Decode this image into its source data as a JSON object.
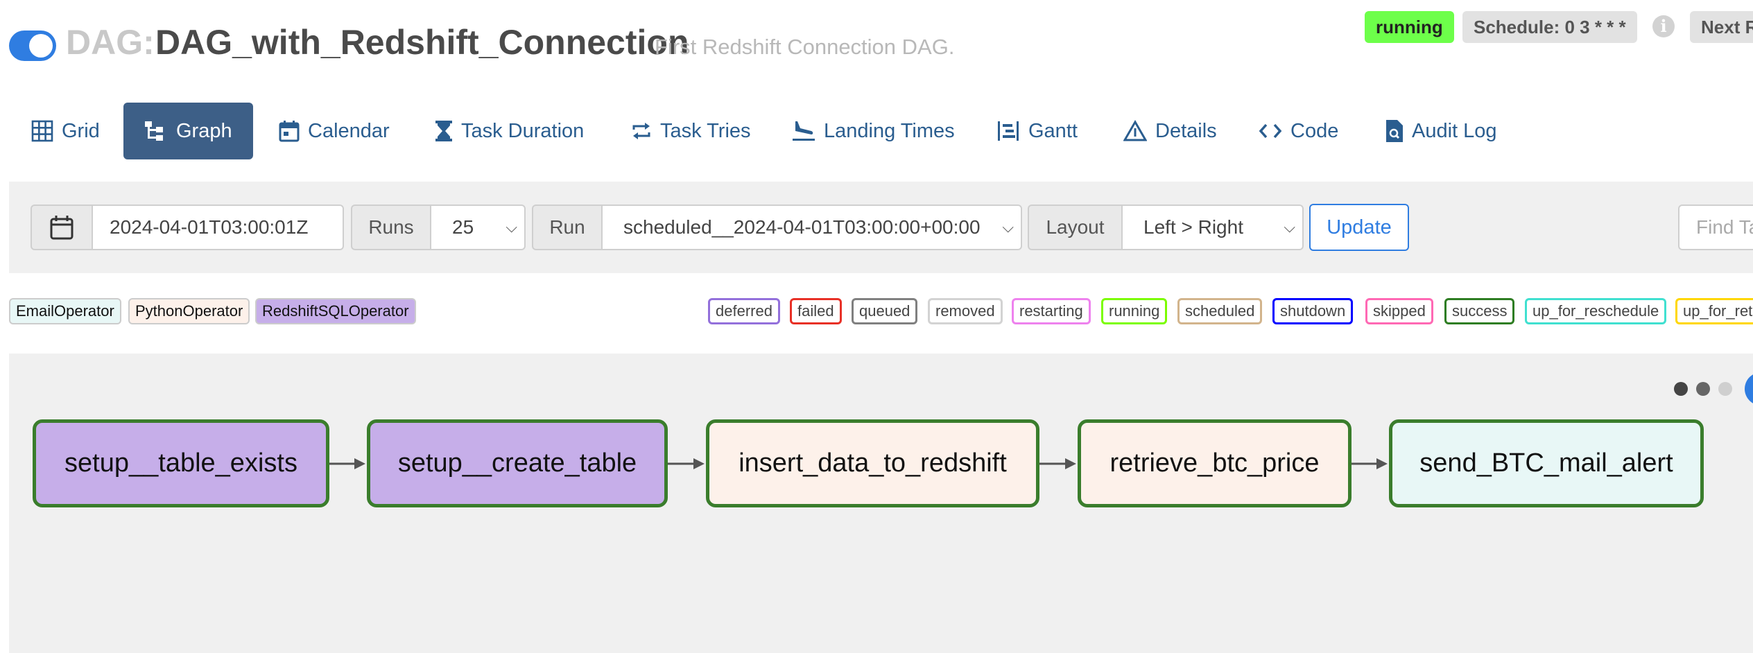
{
  "header": {
    "dag_prefix": "DAG:",
    "dag_name": "DAG_with_Redshift_Connection",
    "description": "First Redshift Connection DAG.",
    "state_badge": "running",
    "schedule_badge": "Schedule: 0 3 * * *",
    "info_icon": "i",
    "next_run_badge": "Next R"
  },
  "tabs": [
    {
      "label": "Grid",
      "icon": "grid-icon",
      "active": false
    },
    {
      "label": "Graph",
      "icon": "graph-icon",
      "active": true
    },
    {
      "label": "Calendar",
      "icon": "calendar-icon",
      "active": false
    },
    {
      "label": "Task Duration",
      "icon": "hourglass-icon",
      "active": false
    },
    {
      "label": "Task Tries",
      "icon": "repeat-icon",
      "active": false
    },
    {
      "label": "Landing Times",
      "icon": "plane-landing-icon",
      "active": false
    },
    {
      "label": "Gantt",
      "icon": "gantt-icon",
      "active": false
    },
    {
      "label": "Details",
      "icon": "warning-triangle-icon",
      "active": false
    },
    {
      "label": "Code",
      "icon": "code-icon",
      "active": false
    },
    {
      "label": "Audit Log",
      "icon": "search-document-icon",
      "active": false
    }
  ],
  "toolbar": {
    "base_date": "2024-04-01T03:00:01Z",
    "runs_label": "Runs",
    "runs_value": "25",
    "run_label": "Run",
    "run_value": "scheduled__2024-04-01T03:00:00+00:00",
    "layout_label": "Layout",
    "layout_value": "Left > Right",
    "update_label": "Update",
    "find_placeholder": "Find Ta"
  },
  "operator_legend": [
    {
      "label": "EmailOperator",
      "color": "#e8f7f6"
    },
    {
      "label": "PythonOperator",
      "color": "#fdf1ea"
    },
    {
      "label": "RedshiftSQLOperator",
      "color": "#c6aee9"
    }
  ],
  "state_legend": [
    {
      "label": "deferred",
      "color": "#9370db"
    },
    {
      "label": "failed",
      "color": "#e83026"
    },
    {
      "label": "queued",
      "color": "#808080"
    },
    {
      "label": "removed",
      "color": "#d3d3d3"
    },
    {
      "label": "restarting",
      "color": "#ee82ee"
    },
    {
      "label": "running",
      "color": "#7cfc00"
    },
    {
      "label": "scheduled",
      "color": "#d2b48c"
    },
    {
      "label": "shutdown",
      "color": "#0000ff"
    },
    {
      "label": "skipped",
      "color": "#ff69b4"
    },
    {
      "label": "success",
      "color": "#2e7d22"
    },
    {
      "label": "up_for_reschedule",
      "color": "#40e0d0"
    },
    {
      "label": "up_for_retry",
      "color": "#ffd700"
    }
  ],
  "graph": {
    "nodes": [
      {
        "label": "setup__table_exists",
        "color": "#c6aee9"
      },
      {
        "label": "setup__create_table",
        "color": "#c6aee9"
      },
      {
        "label": "insert_data_to_redshift",
        "color": "#fdf1ea"
      },
      {
        "label": "retrieve_btc_price",
        "color": "#fdf1ea"
      },
      {
        "label": "send_BTC_mail_alert",
        "color": "#e8f7f6"
      }
    ],
    "node_border_color": "#3a7d2c"
  },
  "colors": {
    "accent": "#2f7de1",
    "active_tab": "#3d5f87",
    "link": "#2a5d8f"
  }
}
